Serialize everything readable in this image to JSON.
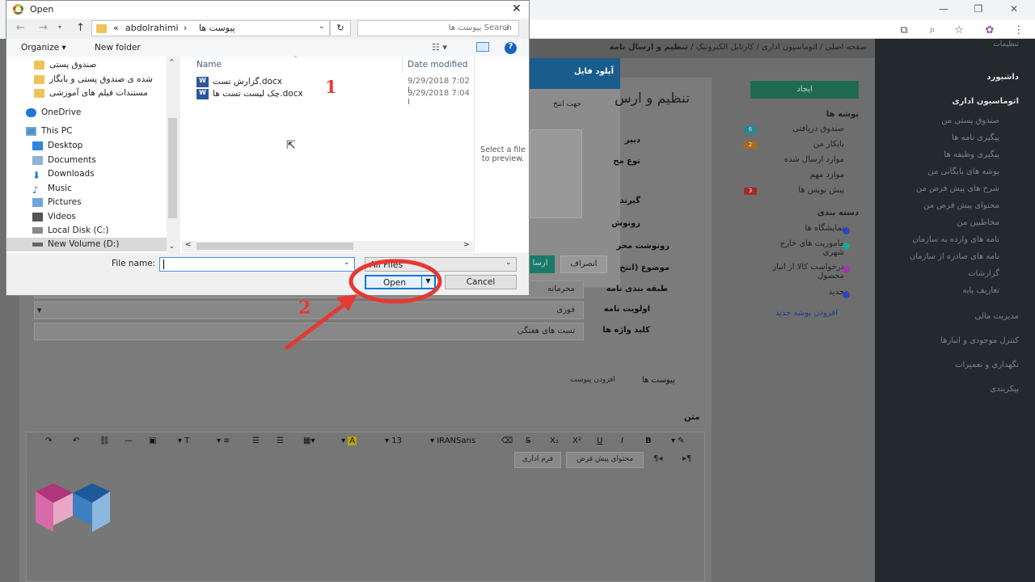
{
  "dialog": {
    "title": "Open",
    "address": {
      "prefix": "«",
      "path1": "abdolrahimi",
      "sep": "›",
      "path2": "پیوست ها"
    },
    "search_placeholder": "Search پیوست ها",
    "organize_label": "Organize ▾",
    "new_folder_label": "New folder",
    "nav_items": [
      {
        "label": "صندوق پستی",
        "icon": "folder-icon"
      },
      {
        "label": "شده ی صندوق پستی و بایگار",
        "icon": "folder-icon"
      },
      {
        "label": "مستندات فیلم های آموزشی",
        "icon": "folder-icon"
      },
      {
        "label": "OneDrive",
        "icon": "cloud-icon"
      },
      {
        "label": "This PC",
        "icon": "computer-icon"
      },
      {
        "label": "Desktop",
        "icon": "desktop-icon"
      },
      {
        "label": "Documents",
        "icon": "documents-icon"
      },
      {
        "label": "Downloads",
        "icon": "download-icon"
      },
      {
        "label": "Music",
        "icon": "music-icon"
      },
      {
        "label": "Pictures",
        "icon": "pictures-icon"
      },
      {
        "label": "Videos",
        "icon": "videos-icon"
      },
      {
        "label": "Local Disk (C:)",
        "icon": "disk-icon"
      },
      {
        "label": "New Volume (D:)",
        "icon": "disk-icon"
      }
    ],
    "columns": {
      "name": "Name",
      "date": "Date modified"
    },
    "files": [
      {
        "name": "گزارش تست.docx",
        "date": "9/29/2018 7:02 I"
      },
      {
        "name": "چک لیست تست ها.docx",
        "date": "9/29/2018 7:04 I"
      }
    ],
    "preview_text": "Select a file to preview.",
    "file_name_label": "File name:",
    "file_name_value": "",
    "file_type_value": "All Files",
    "open_label": "Open",
    "cancel_label": "Cancel"
  },
  "annotations": {
    "step1": "1",
    "step2": "2"
  },
  "colors": {
    "annotation": "#e53935",
    "accent": "#0078d7",
    "sidebar": "#24292e"
  },
  "breadcrumb": [
    "صفحه اصلی",
    "اتوماسیون اداری",
    "کارتابل الکترونیک",
    "تنظیم و ارسال نامه"
  ],
  "upload_modal": {
    "title": "آپلود فایل",
    "hint": "جهت انتخ",
    "cancel": "انصراف",
    "send": "ارسا"
  },
  "main_title": "تنظیم و ارس",
  "nav2": {
    "create": "ایجاد",
    "folders_title": "پوشه ها",
    "folders": [
      "صندوق دریافتی",
      "بایکار من",
      "موارد ارسال شده",
      "موارد مهم",
      "پیش نویس ها"
    ],
    "badges": [
      "6",
      "2",
      "",
      "",
      "3"
    ],
    "cats_title": "دسته بندی",
    "cats": [
      "نمایشگاه ها",
      "ماموریت های خارج شهری",
      "درخواست کالا از انبار محصول",
      "جدید"
    ],
    "add_folder": "افزودن پوشه جدید"
  },
  "sidebar": {
    "top": "تنظیمات",
    "items": [
      "داشبورد",
      "اتوماسیون اداری",
      "صندوق پستی من",
      "پیگیری نامه ها",
      "پیگیری وظیفه ها",
      "پوشه های بایگانی من",
      "شرح های پیش فرض من",
      "محتوای پیش فرض من",
      "مخاطبین من",
      "نامه های وارده به سازمان",
      "نامه های صادره از سازمان",
      "گزارشات",
      "تعاریف پایه",
      "مدیریت مالی",
      "کنترل موجودی و انبارها",
      "نگهداری و تعمیرات",
      "پیکربندی"
    ]
  },
  "form": {
    "labels": [
      "دبیر",
      "نوع مح",
      "گیرند",
      "رونوش",
      "رونوشت محر",
      "موضوع (انتخ",
      "طبقه بندی نامه",
      "اولویت نامه",
      "کلید واژه ها"
    ],
    "class_value": "محرمانه",
    "priority_value": "فوری",
    "keywords_value": "تست های هفتگی",
    "attach": "پیوست ها",
    "add_attach": "افزودن پیوست",
    "body_label": "متن"
  },
  "editor": {
    "font": "IRANSans",
    "size": "13",
    "btn_default": "محتوای پیش فرض",
    "btn_form": "فرم اداری"
  }
}
